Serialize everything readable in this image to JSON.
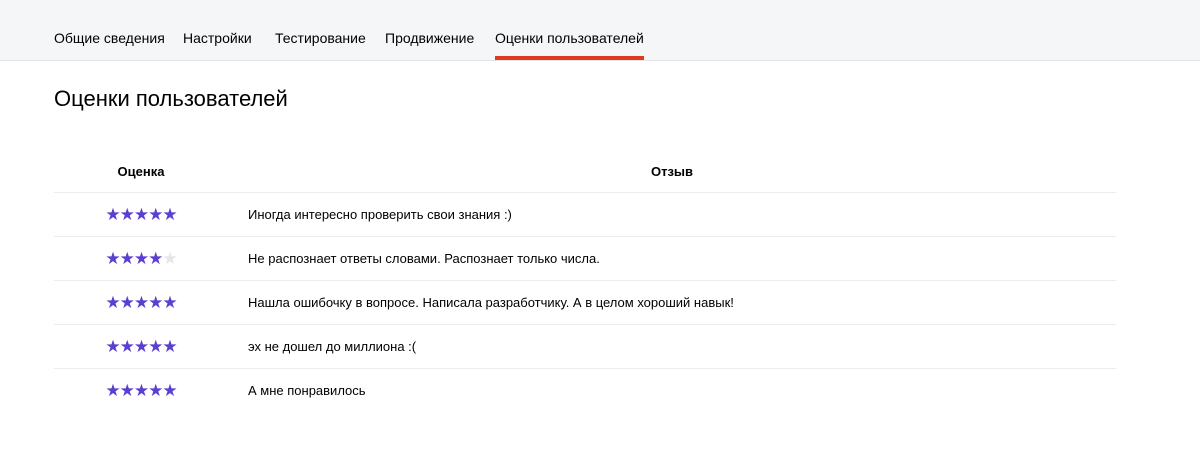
{
  "tabs": [
    {
      "label": "Общие сведения",
      "active": false
    },
    {
      "label": "Настройки",
      "active": false
    },
    {
      "label": "Тестирование",
      "active": false
    },
    {
      "label": "Продвижение",
      "active": false
    },
    {
      "label": "Оценки пользователей",
      "active": true
    }
  ],
  "page_title": "Оценки пользователей",
  "table": {
    "headers": {
      "rating": "Оценка",
      "review": "Отзыв"
    },
    "max_rating": 5,
    "rows": [
      {
        "rating": 5,
        "review": "Иногда интересно проверить свои знания :)"
      },
      {
        "rating": 4,
        "review": "Не распознает ответы словами. Распознает только числа."
      },
      {
        "rating": 5,
        "review": "Нашла ошибочку в вопросе. Написала разработчику. А в целом хороший навык!"
      },
      {
        "rating": 5,
        "review": "эх не дошел до миллиона :("
      },
      {
        "rating": 5,
        "review": "А мне понравилось"
      }
    ]
  },
  "colors": {
    "accent": "#e0391f",
    "star_filled": "#5b3fd1",
    "star_empty": "#e4e6ea"
  }
}
